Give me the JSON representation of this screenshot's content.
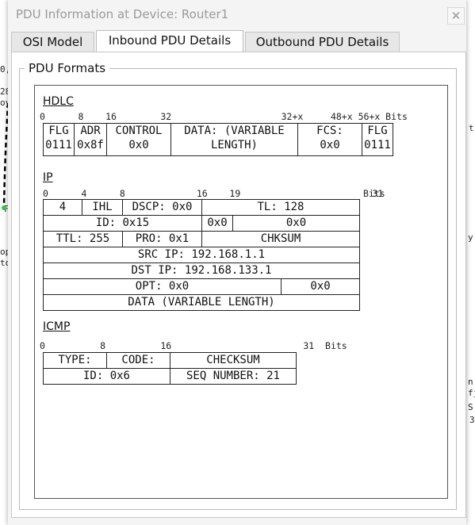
{
  "window": {
    "title": "PDU Information at Device: Router1",
    "close_glyph": "✕"
  },
  "tabs": [
    "OSI Model",
    "Inbound PDU Details",
    "Outbound PDU Details"
  ],
  "fieldset_label": "PDU Formats",
  "background_fragments": [
    "0,",
    "28",
    "oy",
    "op",
    "to",
    "F",
    "t",
    "y",
    "n",
    "fj",
    "S,",
    "3"
  ],
  "hdlc": {
    "title": "HDLC",
    "bits": "0      8    16        32                    32+x     48+x 56+x Bits",
    "cells": [
      {
        "l1": "FLG",
        "l2": "0111"
      },
      {
        "l1": "ADR",
        "l2": "0x8f"
      },
      {
        "l1": "CONTROL",
        "l2": "0x0"
      },
      {
        "l1": "DATA: (VARIABLE",
        "l2": "LENGTH)"
      },
      {
        "l1": "FCS:",
        "l2": "0x0"
      },
      {
        "l1": "FLG",
        "l2": "0111"
      }
    ]
  },
  "ip": {
    "title": "IP",
    "bits": "0      4      8             16    19                        31",
    "bits_suffix": "Bits",
    "rows": [
      [
        "4",
        "IHL",
        "DSCP: 0x0",
        "TL: 128"
      ],
      [
        "ID: 0x15",
        "0x0",
        "0x0"
      ],
      [
        "TTL: 255",
        "PRO: 0x1",
        "CHKSUM"
      ],
      [
        "SRC IP: 192.168.1.1"
      ],
      [
        "DST IP: 192.168.133.1"
      ],
      [
        "OPT: 0x0",
        "0x0"
      ],
      [
        "DATA (VARIABLE LENGTH)"
      ]
    ]
  },
  "icmp": {
    "title": "ICMP",
    "bits": "0          8          16                        31  Bits",
    "rows": [
      [
        "TYPE:",
        "CODE:",
        "CHECKSUM"
      ],
      [
        "ID: 0x6",
        "SEQ NUMBER: 21"
      ]
    ]
  }
}
